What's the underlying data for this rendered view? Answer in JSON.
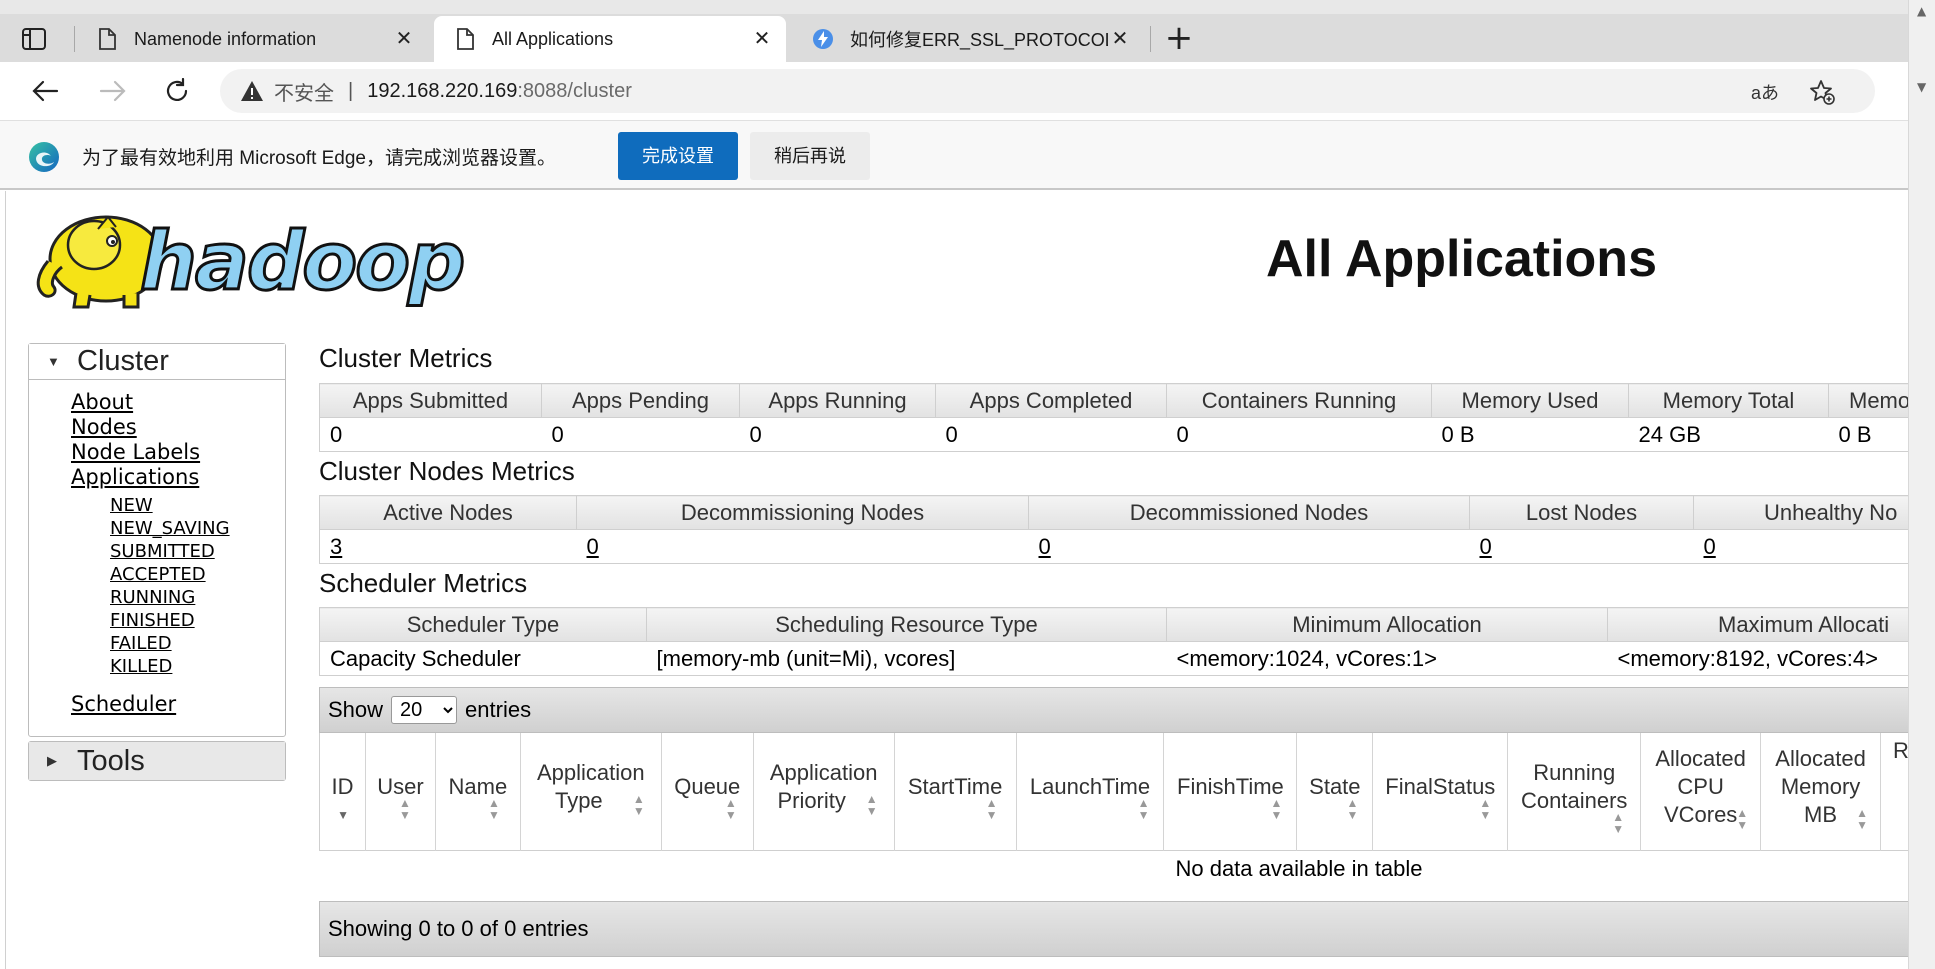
{
  "browser": {
    "tabs": [
      {
        "title": "Namenode information",
        "close": "✕"
      },
      {
        "title": "All Applications",
        "close": "✕"
      },
      {
        "title": "如何修复ERR_SSL_PROTOCOL_ER",
        "close": "✕"
      }
    ],
    "new_tab": "+",
    "address": {
      "security_label": "不安全",
      "separator": "|",
      "host": "192.168.220.169",
      "path": ":8088/cluster",
      "read_aloud": "aあ"
    },
    "infobar": {
      "message": "为了最有效地利用 Microsoft Edge，请完成浏览器设置。",
      "primary_button": "完成设置",
      "secondary_button": "稍后再说"
    }
  },
  "page": {
    "heading": "All Applications",
    "logo_text": "hadoop",
    "sidebar": {
      "cluster_title": "Cluster",
      "links": [
        "About",
        "Nodes",
        "Node Labels",
        "Applications"
      ],
      "app_states": [
        "NEW",
        "NEW_SAVING",
        "SUBMITTED",
        "ACCEPTED",
        "RUNNING",
        "FINISHED",
        "FAILED",
        "KILLED"
      ],
      "scheduler_link": "Scheduler",
      "tools_title": "Tools"
    },
    "cluster_metrics": {
      "title": "Cluster Metrics",
      "headers": [
        "Apps Submitted",
        "Apps Pending",
        "Apps Running",
        "Apps Completed",
        "Containers Running",
        "Memory Used",
        "Memory Total",
        "Memo"
      ],
      "values": [
        "0",
        "0",
        "0",
        "0",
        "0",
        "0 B",
        "24 GB",
        "0 B"
      ]
    },
    "nodes_metrics": {
      "title": "Cluster Nodes Metrics",
      "headers": [
        "Active Nodes",
        "Decommissioning Nodes",
        "Decommissioned Nodes",
        "Lost Nodes",
        "Unhealthy No"
      ],
      "values": [
        "3",
        "0",
        "0",
        "0",
        "0"
      ]
    },
    "scheduler_metrics": {
      "title": "Scheduler Metrics",
      "headers": [
        "Scheduler Type",
        "Scheduling Resource Type",
        "Minimum Allocation",
        "Maximum Allocati"
      ],
      "values": [
        "Capacity Scheduler",
        "[memory-mb (unit=Mi), vcores]",
        "<memory:1024, vCores:1>",
        "<memory:8192, vCores:4>"
      ]
    },
    "apps_table": {
      "show_label": "Show",
      "entries_label": "entries",
      "page_size": "20",
      "columns": [
        {
          "lines": [
            "ID"
          ]
        },
        {
          "lines": [
            "User"
          ]
        },
        {
          "lines": [
            "Name"
          ]
        },
        {
          "lines": [
            "Application",
            "Type"
          ]
        },
        {
          "lines": [
            "Queue"
          ]
        },
        {
          "lines": [
            "Application",
            "Priority"
          ]
        },
        {
          "lines": [
            "StartTime"
          ]
        },
        {
          "lines": [
            "LaunchTime"
          ]
        },
        {
          "lines": [
            "FinishTime"
          ]
        },
        {
          "lines": [
            "State"
          ]
        },
        {
          "lines": [
            "FinalStatus"
          ]
        },
        {
          "lines": [
            "Running",
            "Containers"
          ]
        },
        {
          "lines": [
            "Allocated",
            "CPU",
            "VCores"
          ]
        },
        {
          "lines": [
            "Allocated",
            "Memory",
            "MB"
          ]
        },
        {
          "lines": [
            "R"
          ]
        }
      ],
      "empty_message": "No data available in table",
      "info": "Showing 0 to 0 of 0 entries"
    }
  }
}
